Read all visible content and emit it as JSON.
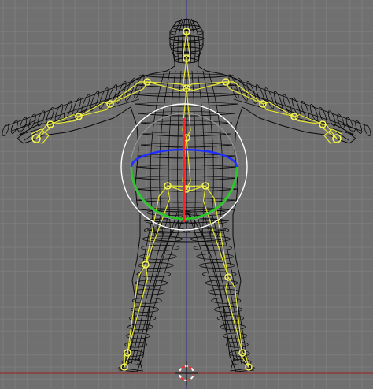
{
  "viewport": {
    "view": "front-orthographic",
    "background_color": "#707070",
    "grid_color": "#7c7c7c",
    "axis_x_color": "#8a3b3b",
    "axis_z_color": "#3b3b8a"
  },
  "mesh": {
    "wire_color": "#0a0a0a"
  },
  "armature": {
    "bone_color": "#e6e632",
    "joint_color": "#f5f55a"
  },
  "gizmo": {
    "outer_circle_color": "#ffffff",
    "trackball_circle_color": "#9a9a9a",
    "x_axis_color": "#1f2fff",
    "y_axis_color": "#22cc22",
    "z_axis_color": "#ff2222"
  },
  "cursor": {
    "color_a": "#ff2a2a",
    "color_b": "#ffffff"
  }
}
